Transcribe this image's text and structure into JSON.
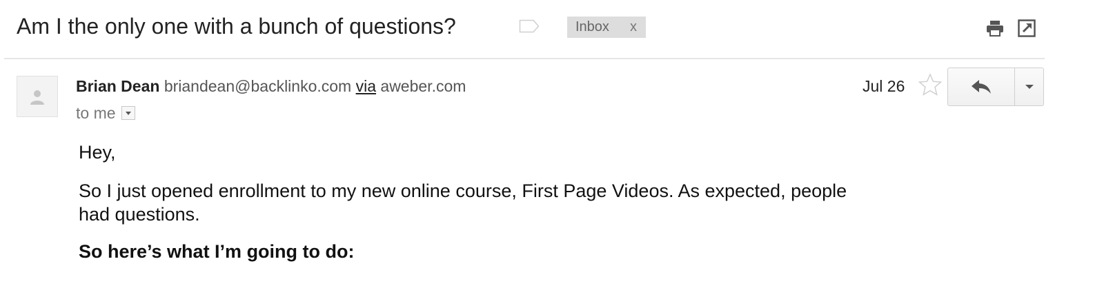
{
  "header": {
    "subject": "Am I the only one with a bunch of questions?",
    "label_icon": "label-tag-icon",
    "inbox_chip": {
      "label": "Inbox",
      "remove": "x"
    },
    "print_icon": "print-icon",
    "new_window_icon": "open-in-new-window-icon"
  },
  "message": {
    "avatar_icon": "person-placeholder-icon",
    "sender_name": "Brian Dean",
    "sender_email": "briandean@backlinko.com",
    "via_label": "via",
    "via_domain": "aweber.com",
    "to_label": "to me",
    "date": "Jul 26",
    "star_icon": "star-outline-icon",
    "reply_icon": "reply-arrow-icon",
    "more_icon": "caret-down-icon"
  },
  "body": {
    "greeting": "Hey,",
    "paragraph1": "So I just opened enrollment to my new online course, First Page Videos. As expected, people had questions.",
    "paragraph2": "So here’s what I’m going to do:"
  },
  "colors": {
    "chip_bg": "#dddddd",
    "chip_text": "#666666",
    "divider": "#e5e5e5",
    "icon_gray": "#555555",
    "star_outline": "#d0d0d0"
  }
}
